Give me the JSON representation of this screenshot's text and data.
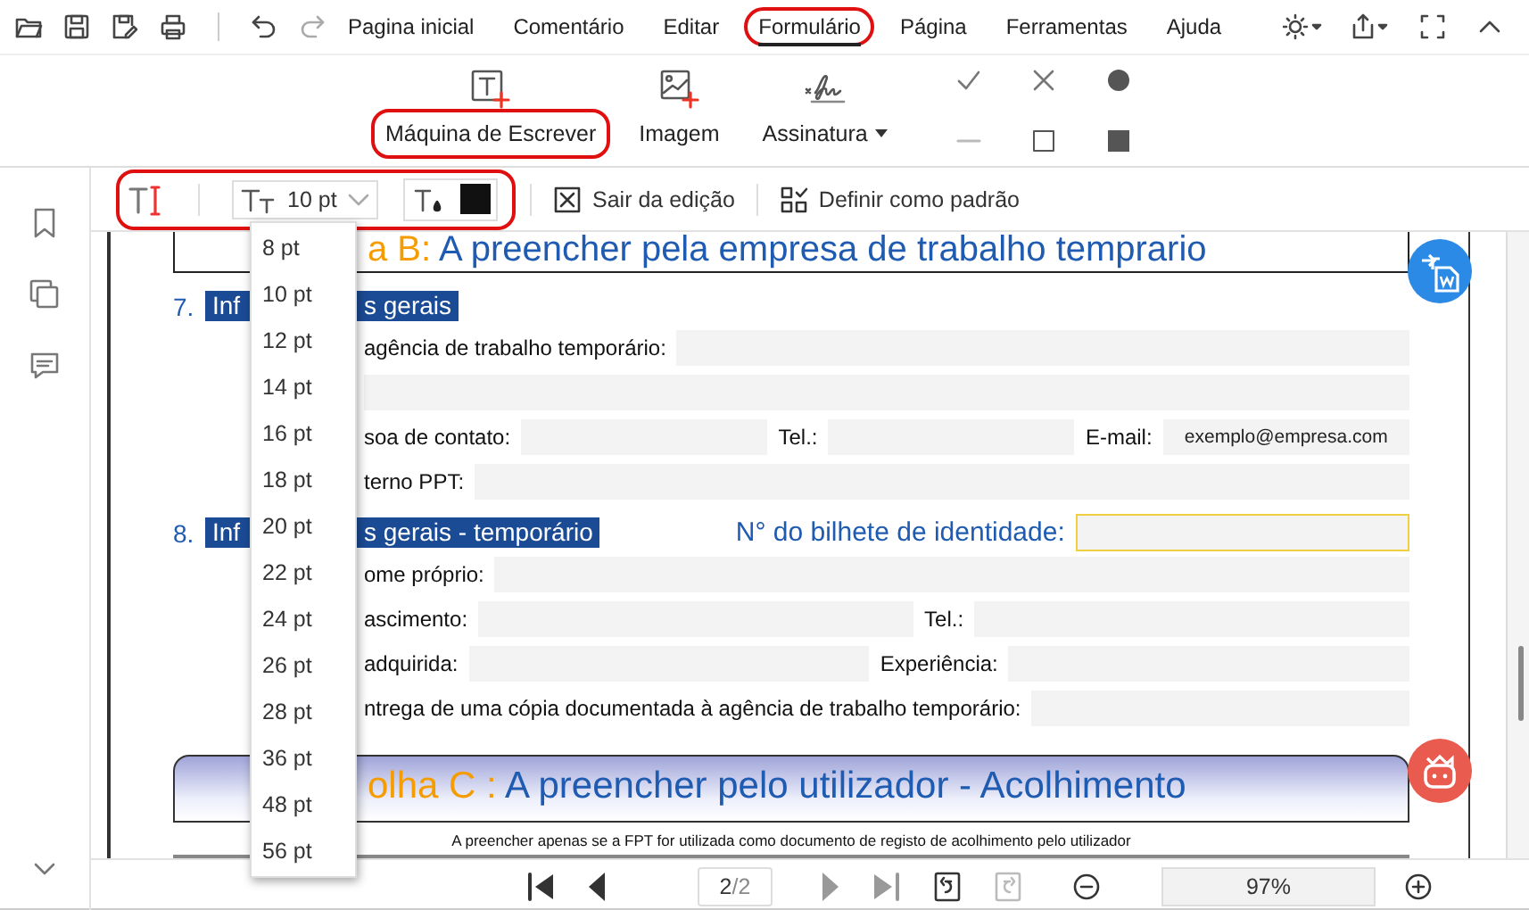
{
  "menu": [
    {
      "label": "Pagina inicial",
      "selected": false,
      "highlighted": false
    },
    {
      "label": "Comentário",
      "selected": false,
      "highlighted": false
    },
    {
      "label": "Editar",
      "selected": false,
      "highlighted": false
    },
    {
      "label": "Formulário",
      "selected": true,
      "highlighted": true
    },
    {
      "label": "Página",
      "selected": false,
      "highlighted": false
    },
    {
      "label": "Ferramentas",
      "selected": false,
      "highlighted": false
    },
    {
      "label": "Ajuda",
      "selected": false,
      "highlighted": false
    }
  ],
  "ribbon": {
    "tools": [
      {
        "kind": "typewriter",
        "label": "Máquina de Escrever",
        "highlighted": true,
        "dropdown": false
      },
      {
        "kind": "image",
        "label": "Imagem",
        "highlighted": false,
        "dropdown": false
      },
      {
        "kind": "signature",
        "label": "Assinatura",
        "highlighted": false,
        "dropdown": true
      }
    ]
  },
  "edit_bar": {
    "highlighted": true,
    "font_size": "10 pt",
    "buttons": [
      {
        "kind": "exit",
        "label": "Sair da edição"
      },
      {
        "kind": "default",
        "label": "Definir como padrão"
      }
    ]
  },
  "size_menu": {
    "options": [
      "8 pt",
      "10 pt",
      "12 pt",
      "14 pt",
      "16 pt",
      "18 pt",
      "20 pt",
      "22 pt",
      "24 pt",
      "26 pt",
      "28 pt",
      "36 pt",
      "48 pt",
      "56 pt"
    ]
  },
  "document": {
    "header": {
      "prefix": "a B:",
      "title": "A preencher pela empresa de trabalho temprario"
    },
    "sections": [
      {
        "number": "7.",
        "title_start": "Inf",
        "title_end": "s gerais",
        "rows": [
          {
            "cells": [
              {
                "kind": "label",
                "text": "agência de trabalho temporário:"
              },
              {
                "kind": "field"
              }
            ]
          },
          {
            "cells": [
              {
                "kind": "field"
              }
            ]
          },
          {
            "cells": [
              {
                "kind": "label",
                "text": "soa de contato:"
              },
              {
                "kind": "field"
              },
              {
                "kind": "label",
                "text": "Tel.:"
              },
              {
                "kind": "field"
              },
              {
                "kind": "label",
                "text": "E-mail:"
              },
              {
                "kind": "field",
                "value": "exemplo@empresa.com"
              }
            ]
          },
          {
            "cells": [
              {
                "kind": "label",
                "text": "terno PPT:"
              },
              {
                "kind": "field"
              }
            ]
          }
        ]
      },
      {
        "number": "8.",
        "title_start": "Inf",
        "title_end": "s gerais - temporário",
        "aside": {
          "label": "N° do bilhete de identidade:",
          "focused": true
        },
        "rows": [
          {
            "cells": [
              {
                "kind": "label",
                "text": "ome próprio:"
              },
              {
                "kind": "field"
              }
            ]
          },
          {
            "cells": [
              {
                "kind": "label",
                "text": "ascimento:"
              },
              {
                "kind": "field"
              },
              {
                "kind": "label",
                "text": "Tel.:"
              },
              {
                "kind": "field"
              }
            ]
          },
          {
            "cells": [
              {
                "kind": "label",
                "text": "adquirida:"
              },
              {
                "kind": "field"
              },
              {
                "kind": "label",
                "text": "Experiência:"
              },
              {
                "kind": "field"
              }
            ]
          },
          {
            "cells": [
              {
                "kind": "label",
                "text": "ntrega de uma cópia documentada à agência de trabalho temporário:"
              },
              {
                "kind": "field"
              }
            ]
          }
        ]
      }
    ],
    "banner": {
      "prefix": "olha C :",
      "title": "A preencher pelo utilizador - Acolhimento"
    },
    "note": "A preencher apenas se a FPT for utilizada como documento de registo de acolhimento pelo utilizador"
  },
  "pager": {
    "page": "2",
    "total": "/2",
    "zoom": "97%"
  }
}
